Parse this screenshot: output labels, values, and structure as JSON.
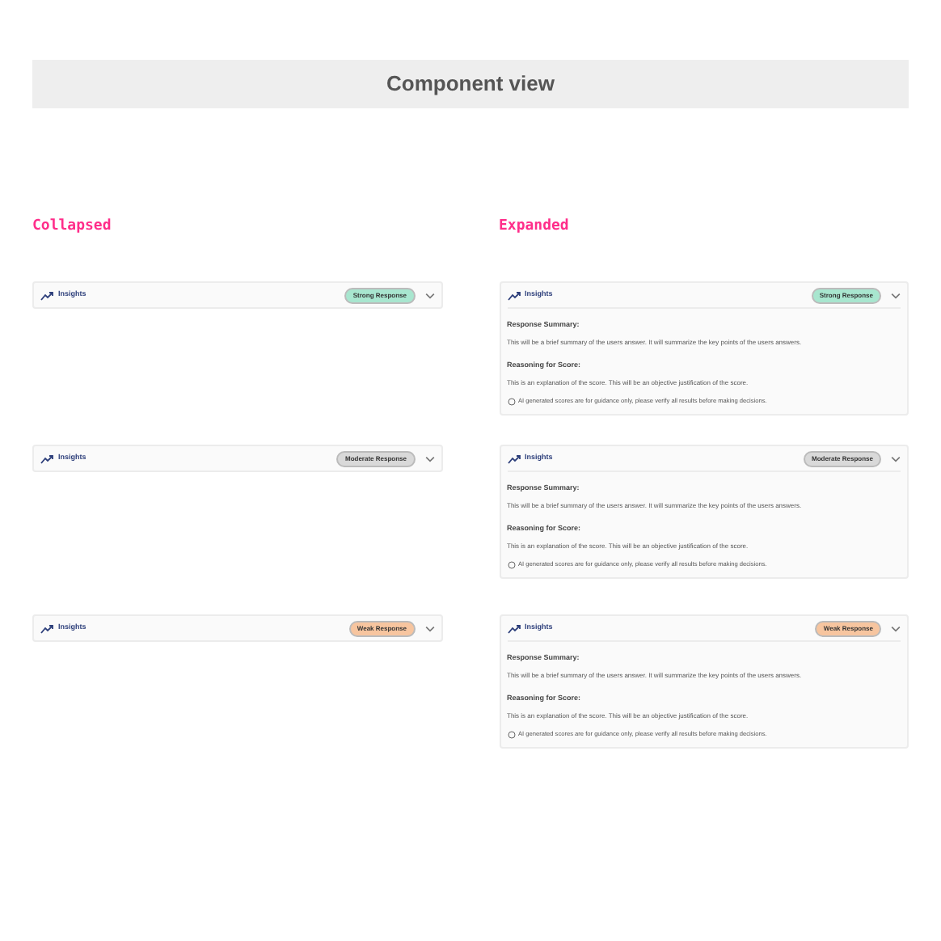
{
  "header": {
    "title": "Component view"
  },
  "columns": [
    {
      "label": "Collapsed",
      "expanded": false,
      "cards": [
        {
          "title": "Insights",
          "badge": {
            "text": "Strong Response",
            "color": "#a8e6cf"
          }
        },
        {
          "title": "Insights",
          "badge": {
            "text": "Moderate Response",
            "color": "#d9d9d9"
          }
        },
        {
          "title": "Insights",
          "badge": {
            "text": "Weak Response",
            "color": "#f7c59f"
          }
        }
      ]
    },
    {
      "label": "Expanded",
      "expanded": true,
      "cards": [
        {
          "title": "Insights",
          "badge": {
            "text": "Strong Response",
            "color": "#a8e6cf"
          },
          "summary_label": "Response Summary:",
          "summary": "This will be a brief summary of the users answer. It will summarize the key points of the users answers.",
          "reasoning_label": "Reasoning for Score:",
          "reasoning": "This is an explanation of the score. This will be an objective justification of the score.",
          "disclaimer": "AI generated scores are for guidance only, please verify all results before making decisions."
        },
        {
          "title": "Insights",
          "badge": {
            "text": "Moderate Response",
            "color": "#d9d9d9"
          },
          "summary_label": "Response Summary:",
          "summary": "This will be a brief summary of the users answer. It will summarize the key points of the users answers.",
          "reasoning_label": "Reasoning for Score:",
          "reasoning": "This is an explanation of the score. This will be an objective justification of the score.",
          "disclaimer": "AI generated scores are for guidance only, please verify all results before making decisions."
        },
        {
          "title": "Insights",
          "badge": {
            "text": "Weak Response",
            "color": "#f7c59f"
          },
          "summary_label": "Response Summary:",
          "summary": "This will be a brief summary of the users answer. It will summarize the key points of the users answers.",
          "reasoning_label": "Reasoning for Score:",
          "reasoning": "This is an explanation of the score. This will be an objective justification of the score.",
          "disclaimer": "AI generated scores are for guidance only, please verify all results before making decisions."
        }
      ]
    }
  ]
}
